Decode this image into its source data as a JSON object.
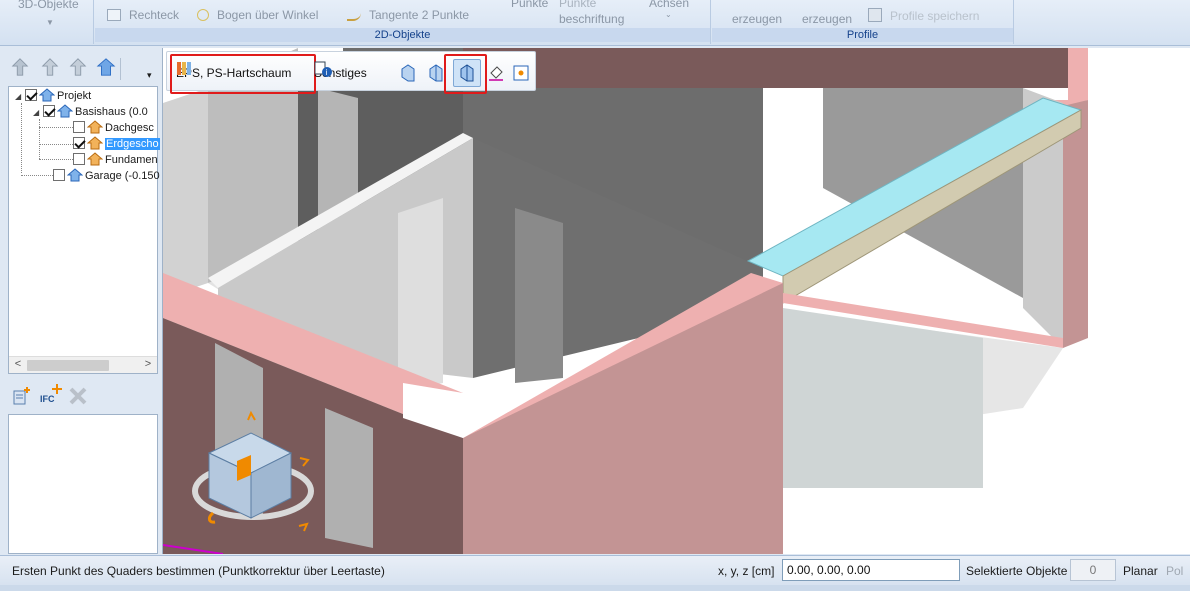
{
  "ribbon": {
    "group_3d_label": "3D-Objekte",
    "btn_rechteck": "Rechteck",
    "btn_bogen": "Bogen über Winkel",
    "btn_tangente": "Tangente 2 Punkte",
    "btn_punkte": "Punkte",
    "btn_beschriftung": "beschriftung",
    "btn_achsen": "Achsen",
    "group_2d_title": "2D-Objekte",
    "btn_erzeugen1": "erzeugen",
    "btn_erzeugen2": "erzeugen",
    "btn_profile_speichern": "Profile speichern",
    "group_profile_title": "Profile"
  },
  "tree": {
    "root": "Projekt",
    "basishaus": "Basishaus (0.0",
    "dachgeschoss": "Dachgesc",
    "erdgeschoss": "Erdgescho",
    "fundament": "Fundamen",
    "garage": "Garage (-0.150"
  },
  "scroll": {
    "left": "<",
    "right": ">"
  },
  "ifc": {
    "label": "IFC"
  },
  "material_bar": {
    "material_label": "EPS, PS-Hartschaum",
    "sonstiges_label": "Sonstiges"
  },
  "status": {
    "prompt": "Ersten Punkt des Quaders bestimmen (Punktkorrektur über Leertaste)",
    "coord_label": "x, y, z [cm]",
    "coord_value": "0.00, 0.00, 0.00",
    "selected_label": "Selektierte Objekte",
    "selected_count": "0",
    "planar_label": "Planar",
    "polar_label": "Pol"
  },
  "colors": {
    "wall_top": "#eeb0b0",
    "wall_outer": "#c39494",
    "wall_dark": "#7a5a5a",
    "wall_inner_dark": "#6e6e6e",
    "wall_inner_light": "#d8d8d8",
    "insulation_top": "#a6e8f2",
    "insulation_side": "#d2cbb0",
    "highlight": "#e01b1b"
  }
}
